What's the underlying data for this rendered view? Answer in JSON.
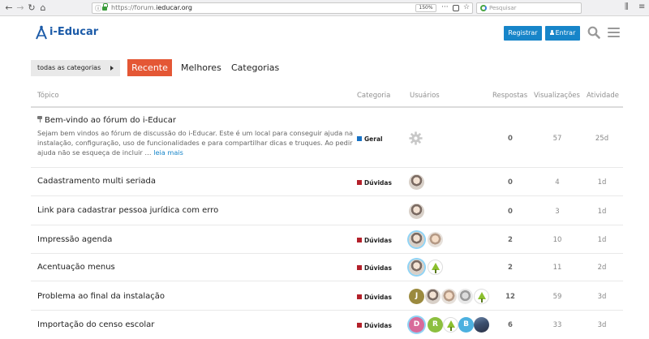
{
  "browser": {
    "url_prefix": "https://forum.",
    "url_domain": "ieducar.org",
    "zoom": "150%",
    "search_placeholder": "Pesquisar"
  },
  "site": {
    "logo_text": "i-Educar",
    "register_label": "Registrar",
    "login_label": "Entrar",
    "brand_color": "#1785c9",
    "accent_color": "#e45735"
  },
  "filters": {
    "category_dropdown": "todas as categorias",
    "tabs": [
      "Recente",
      "Melhores",
      "Categorias"
    ]
  },
  "table": {
    "headers": {
      "topic": "Tópico",
      "category": "Categoria",
      "users": "Usuários",
      "replies": "Respostas",
      "views": "Visualizações",
      "activity": "Atividade"
    },
    "pinned": {
      "title": "Bem-vindo ao fórum do i-Educar",
      "excerpt": "Sejam bem vindos ao fórum de discussão do i-Educar. Este é um local para conseguir ajuda na instalação, configuração, uso de funcionalidades e para compartilhar dicas e truques. Ao pedir ajuda não se esqueça de incluir …",
      "read_more": "leia mais",
      "category": "Geral",
      "category_color": "#1771c4",
      "replies": "0",
      "views": "57",
      "activity": "25d"
    },
    "rows": [
      {
        "title": "Cadastramento multi seriada",
        "category": "Dúvidas",
        "category_color": "#b3202a",
        "replies": "0",
        "views": "4",
        "activity": "1d"
      },
      {
        "title": "Link para cadastrar pessoa jurídica com erro",
        "category": "",
        "category_color": "",
        "replies": "0",
        "views": "3",
        "activity": "1d"
      },
      {
        "title": "Impressão agenda",
        "category": "Dúvidas",
        "category_color": "#b3202a",
        "replies": "2",
        "views": "10",
        "activity": "1d"
      },
      {
        "title": "Acentuação menus",
        "category": "Dúvidas",
        "category_color": "#b3202a",
        "replies": "2",
        "views": "11",
        "activity": "2d"
      },
      {
        "title": "Problema ao final da instalação",
        "category": "Dúvidas",
        "category_color": "#b3202a",
        "replies": "12",
        "views": "59",
        "activity": "3d"
      },
      {
        "title": "Importação do censo escolar",
        "category": "Dúvidas",
        "category_color": "#b3202a",
        "replies": "6",
        "views": "33",
        "activity": "3d"
      }
    ],
    "avatar_letters": {
      "j": "J",
      "d": "D",
      "r": "R",
      "b": "B"
    }
  }
}
